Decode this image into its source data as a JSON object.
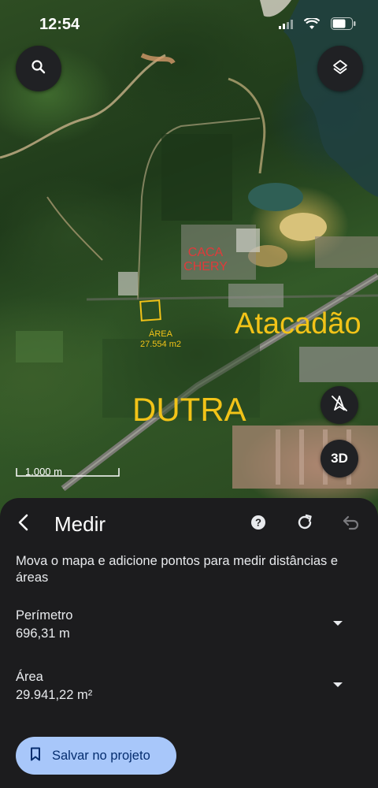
{
  "status_bar": {
    "time": "12:54",
    "icons": [
      "signal-icon",
      "wifi-icon",
      "battery-icon"
    ]
  },
  "map": {
    "controls": {
      "search_icon": "search-icon",
      "layers_icon": "layers-icon",
      "compass_icon": "compass-off-icon",
      "view_3d_label": "3D"
    },
    "labels": {
      "caca_line1": "CACA",
      "caca_line2": "CHERY",
      "atacadao": "Atacadão",
      "dutra": "DUTRA",
      "area_title": "ÁREA",
      "area_value": "27.554 m2"
    },
    "scale_label": "1.000 m",
    "colors": {
      "annotation_yellow": "#f2c318",
      "annotation_red": "#e03a3a"
    }
  },
  "sheet": {
    "title": "Medir",
    "back_icon": "back-icon",
    "help_icon": "help-icon",
    "redo_icon": "refresh-icon",
    "undo_icon": "undo-icon",
    "instruction": "Mova o mapa e adicione pontos para medir distâncias e áreas",
    "perimeter": {
      "label": "Perímetro",
      "value": "696,31 m"
    },
    "area": {
      "label": "Área",
      "value": "29.941,22 m²"
    },
    "save_button": {
      "label": "Salvar no projeto",
      "icon": "bookmark-icon"
    },
    "colors": {
      "background": "#1c1c1e",
      "button_bg": "#a8c7fa",
      "button_text": "#062e6f"
    }
  }
}
